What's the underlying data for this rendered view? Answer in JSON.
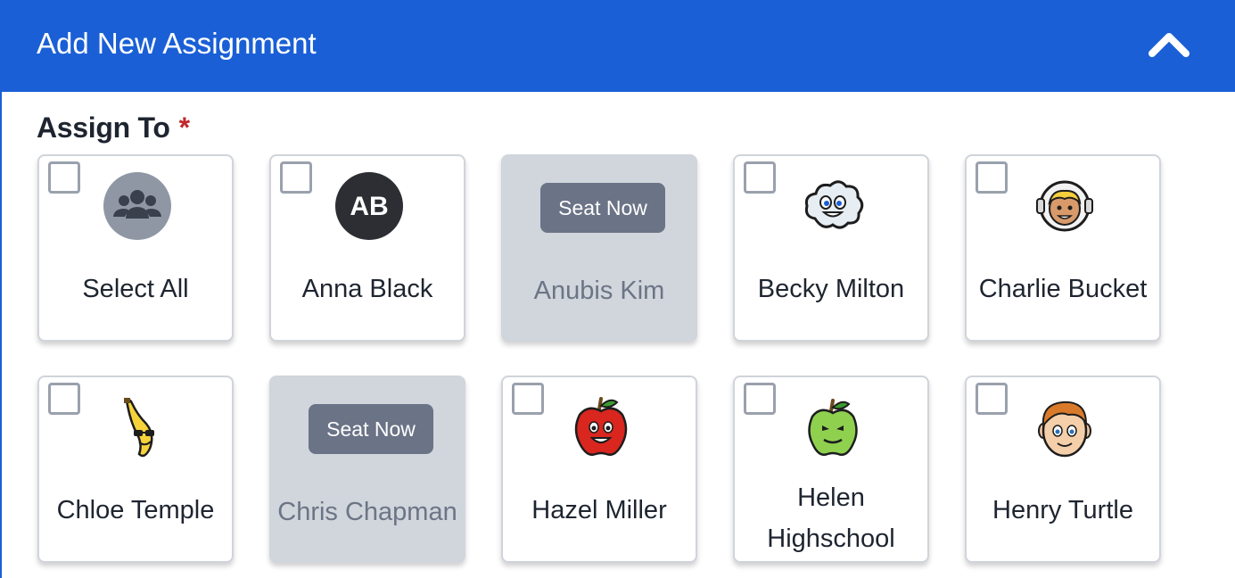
{
  "header": {
    "title": "Add New Assignment",
    "collapse_icon": "chevron-up-icon"
  },
  "section": {
    "label": "Assign To",
    "required_mark": "*"
  },
  "colors": {
    "header_bg": "#1a5fd6",
    "required": "#c0272d",
    "disabled_card": "#d1d5dc",
    "seat_button": "#6b7386"
  },
  "students": [
    {
      "name": "Select All",
      "avatar": "group-icon",
      "state": "selectable"
    },
    {
      "name": "Anna Black",
      "avatar": "initials-avatar",
      "initials": "AB",
      "state": "selectable"
    },
    {
      "name": "Anubis Kim",
      "state": "unseated",
      "action": "Seat Now"
    },
    {
      "name": "Becky Milton",
      "avatar": "cloud-avatar",
      "state": "selectable"
    },
    {
      "name": "Charlie Bucket",
      "avatar": "astronaut-avatar",
      "state": "selectable"
    },
    {
      "name": "Chloe Temple",
      "avatar": "banana-avatar",
      "state": "selectable"
    },
    {
      "name": "Chris Chapman",
      "state": "unseated",
      "action": "Seat Now"
    },
    {
      "name": "Hazel Miller",
      "avatar": "red-apple-avatar",
      "state": "selectable"
    },
    {
      "name": "Helen Highschool",
      "name_lines": [
        "Helen",
        "Highschool"
      ],
      "avatar": "green-apple-avatar",
      "state": "selectable"
    },
    {
      "name": "Henry Turtle",
      "avatar": "boy-avatar",
      "state": "selectable"
    }
  ]
}
